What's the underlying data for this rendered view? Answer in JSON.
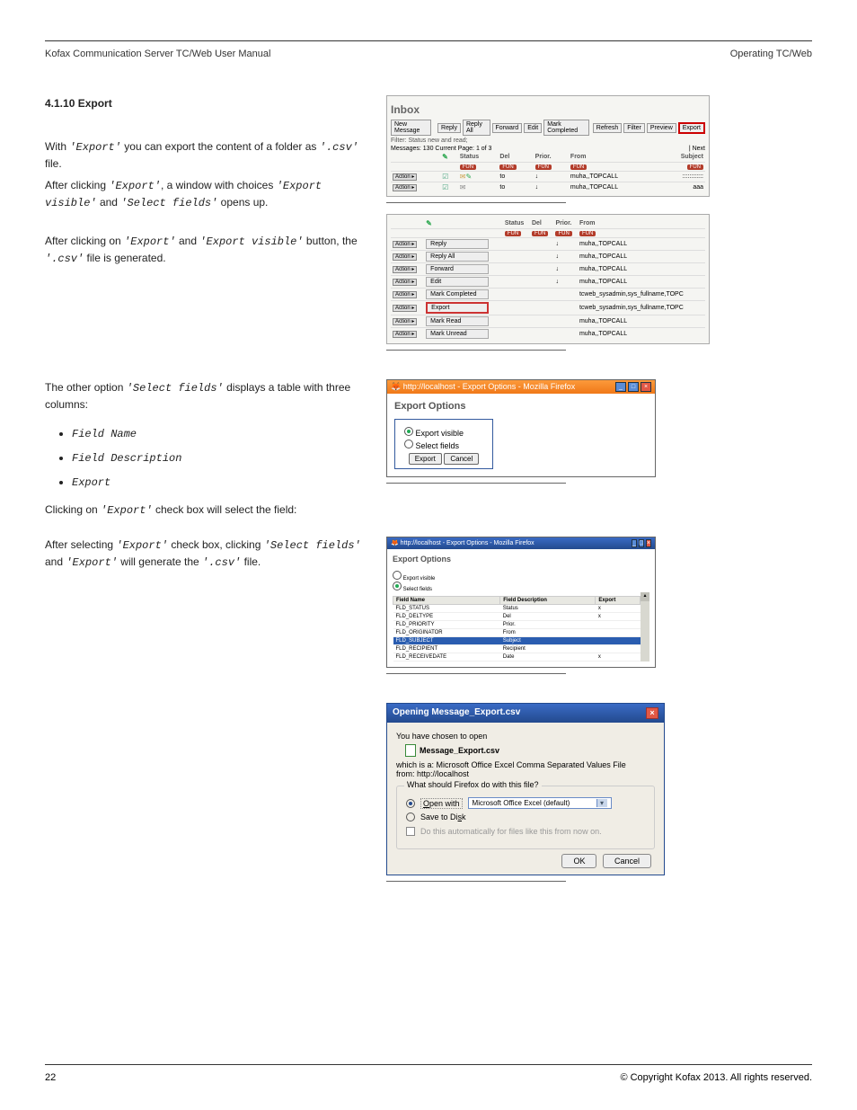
{
  "header": {
    "left": "Kofax Communication Server TC/Web User Manual",
    "right": "Operating TC/Web"
  },
  "section": {
    "title": "4.1.10 Export",
    "p1_a": "With ",
    "p1_b": " you can export the content of a folder as ",
    "p1_c": " file.",
    "csv_ext": "'.csv'",
    "p2_a": "After clicking ",
    "p2_b": ", a window with choices ",
    "p2_c": " and ",
    "p2_d": " opens up.",
    "export_label": "'Export'",
    "export_visible": "'Export visible'",
    "select_fields": "'Select fields'",
    "p3_a": "After clicking on ",
    "p3_b": " and ",
    "p3_c": " button, the ",
    "p3_d": " file is generated.",
    "p4_a": "The other option ",
    "p4_b": " displays a table with three columns:",
    "bullet1": "Field Name",
    "bullet2": "Field Description",
    "bullet3": "Export",
    "p5_a": "Clicking on ",
    "p5_b": " check box will select the field:",
    "p6_a": "After selecting ",
    "p6_b": " check box, clicking ",
    "p6_c": " and ",
    "p6_d": " will generate the ",
    "p6_e": " file."
  },
  "fig1": {
    "title": "Inbox",
    "btn_new": "New Message",
    "btn_reply": "Reply",
    "btn_reply_all": "Reply All",
    "btn_forward": "Forward",
    "btn_edit": "Edit",
    "btn_mark_completed": "Mark Completed",
    "btn_refresh": "Refresh",
    "btn_filter": "Filter",
    "btn_preview": "Preview",
    "btn_export": "Export",
    "filter_text": "Filter: Status new and read;",
    "pager_left": "Messages: 130   Current Page: 1 of 3",
    "pager_right": "| Next",
    "th_status": "Status",
    "th_del": "Del",
    "th_prior": "Prior.",
    "th_from": "From",
    "th_subject": "Subject",
    "pill": "FUN",
    "action": "Action ▸",
    "to": "to",
    "arrow": "↓",
    "from_val": "muha,,TOPCALL",
    "subj_val1": "::::::::::::",
    "subj_val2": "aaa"
  },
  "fig2": {
    "th_status": "Status",
    "th_del": "Del",
    "th_prior": "Prior.",
    "th_from": "From",
    "pill": "FUN",
    "action": "Action ▸",
    "items": [
      "Reply",
      "Reply All",
      "Forward",
      "Edit",
      "Mark Completed",
      "Export",
      "Mark Read",
      "Mark Unread"
    ],
    "arrow": "↓",
    "from_clip": "muha,,TOPCALL",
    "from_long": "tcweb_sysadmin,sys_fullname,TOPC"
  },
  "fig3": {
    "ff_title": "http://localhost - Export Options - Mozilla Firefox",
    "heading": "Export Options",
    "opt1": "Export visible",
    "opt2": "Select fields",
    "btn_export": "Export",
    "btn_cancel": "Cancel"
  },
  "fig4": {
    "ff_title": "http://localhost - Export Options - Mozilla Firefox",
    "heading": "Export Options",
    "opt1": "Export visible",
    "opt2": "Select fields",
    "th_name": "Field Name",
    "th_desc": "Field Description",
    "th_export": "Export",
    "rows": [
      {
        "name": "FLD_STATUS",
        "desc": "Status",
        "x": "x"
      },
      {
        "name": "FLD_DELTYPE",
        "desc": "Del",
        "x": "x"
      },
      {
        "name": "FLD_PRIORITY",
        "desc": "Prior.",
        "x": ""
      },
      {
        "name": "FLD_ORIGINATOR",
        "desc": "From",
        "x": ""
      },
      {
        "name": "FLD_SUBJECT",
        "desc": "Subject",
        "x": ""
      },
      {
        "name": "FLD_RECIPIENT",
        "desc": "Recipient",
        "x": ""
      },
      {
        "name": "FLD_RECEIVEDATE",
        "desc": "Date",
        "x": "x"
      }
    ]
  },
  "fig5": {
    "title": "Opening Message_Export.csv",
    "chosen": "You have chosen to open",
    "filename": "Message_Export.csv",
    "which_is": "which is a:  Microsoft Office Excel Comma Separated Values File",
    "from": "from:  http://localhost",
    "question": "What should Firefox do with this file?",
    "open_with": "Open with",
    "app": "Microsoft Office Excel (default)",
    "save": "Save to Disk",
    "auto": "Do this automatically for files like this from now on.",
    "ok": "OK",
    "cancel": "Cancel"
  },
  "footer": {
    "page": "22",
    "copyright": "© Copyright Kofax 2013. All rights reserved."
  }
}
